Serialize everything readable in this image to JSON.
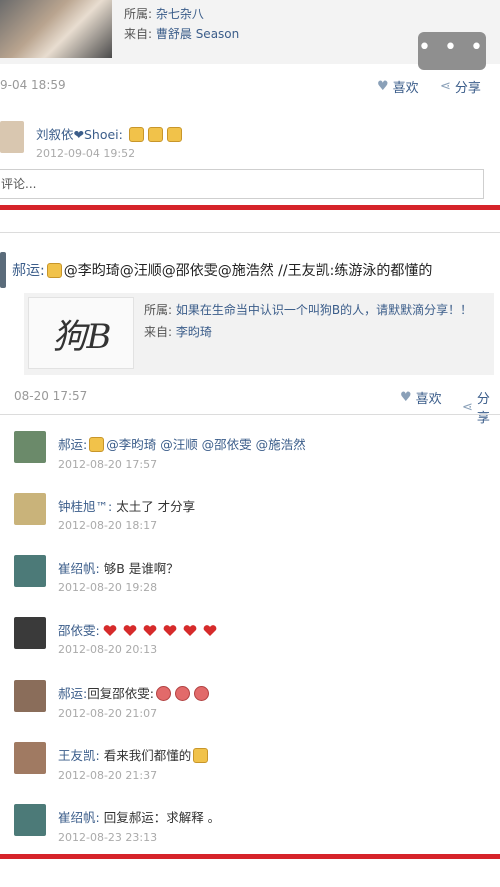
{
  "top_post": {
    "category_label": "所属:",
    "category_value": "杂七杂八",
    "source_label": "来自:",
    "source_value": "曹舒晨 Season",
    "more_button": "• • •",
    "timestamp": "9-04 18:59",
    "like_label": "喜欢",
    "share_label": "分享",
    "comment": {
      "name": "刘叙依❤Shoei:",
      "time": "2012-09-04 19:52"
    },
    "comment_placeholder": "评论..."
  },
  "post": {
    "author": "郝运:",
    "text": "@李昀琦@汪顺@邵依雯@施浩然 //王友凯:练游泳的都懂的",
    "share_card": {
      "image_text": "狗B",
      "category_label": "所属:",
      "category_value": "如果在生命当中认识一个叫狗B的人，请默默滴分享！！",
      "source_label": "来自:",
      "source_value": "李昀琦"
    },
    "timestamp": "08-20 17:57",
    "like_label": "喜欢",
    "share_label": "分享"
  },
  "comments": [
    {
      "name": "郝运:",
      "text": "@李昀琦 @汪顺 @邵依雯 @施浩然",
      "time": "2012-08-20 17:57",
      "avatar_color": "#6b8a6a"
    },
    {
      "name": "钟桂旭™:",
      "text": "太土了 才分享",
      "time": "2012-08-20 18:17",
      "avatar_color": "#c9b37a"
    },
    {
      "name": "崔绍帆:",
      "text": "够B 是谁啊？",
      "time": "2012-08-20 19:28",
      "avatar_color": "#4c7a78"
    },
    {
      "name": "邵依雯:",
      "text": "",
      "time": "2012-08-20 20:13",
      "avatar_color": "#3a3a3a"
    },
    {
      "name": "郝运:",
      "text": "回复邵依雯:",
      "time": "2012-08-20 21:07",
      "avatar_color": "#8a6d5a"
    },
    {
      "name": "王友凯:",
      "text": "看来我们都懂的",
      "time": "2012-08-20 21:37",
      "avatar_color": "#a07a62"
    },
    {
      "name": "崔绍帆:",
      "text": "回复郝运：求解释 。",
      "time": "2012-08-23 23:13",
      "avatar_color": "#4c7a78"
    }
  ]
}
